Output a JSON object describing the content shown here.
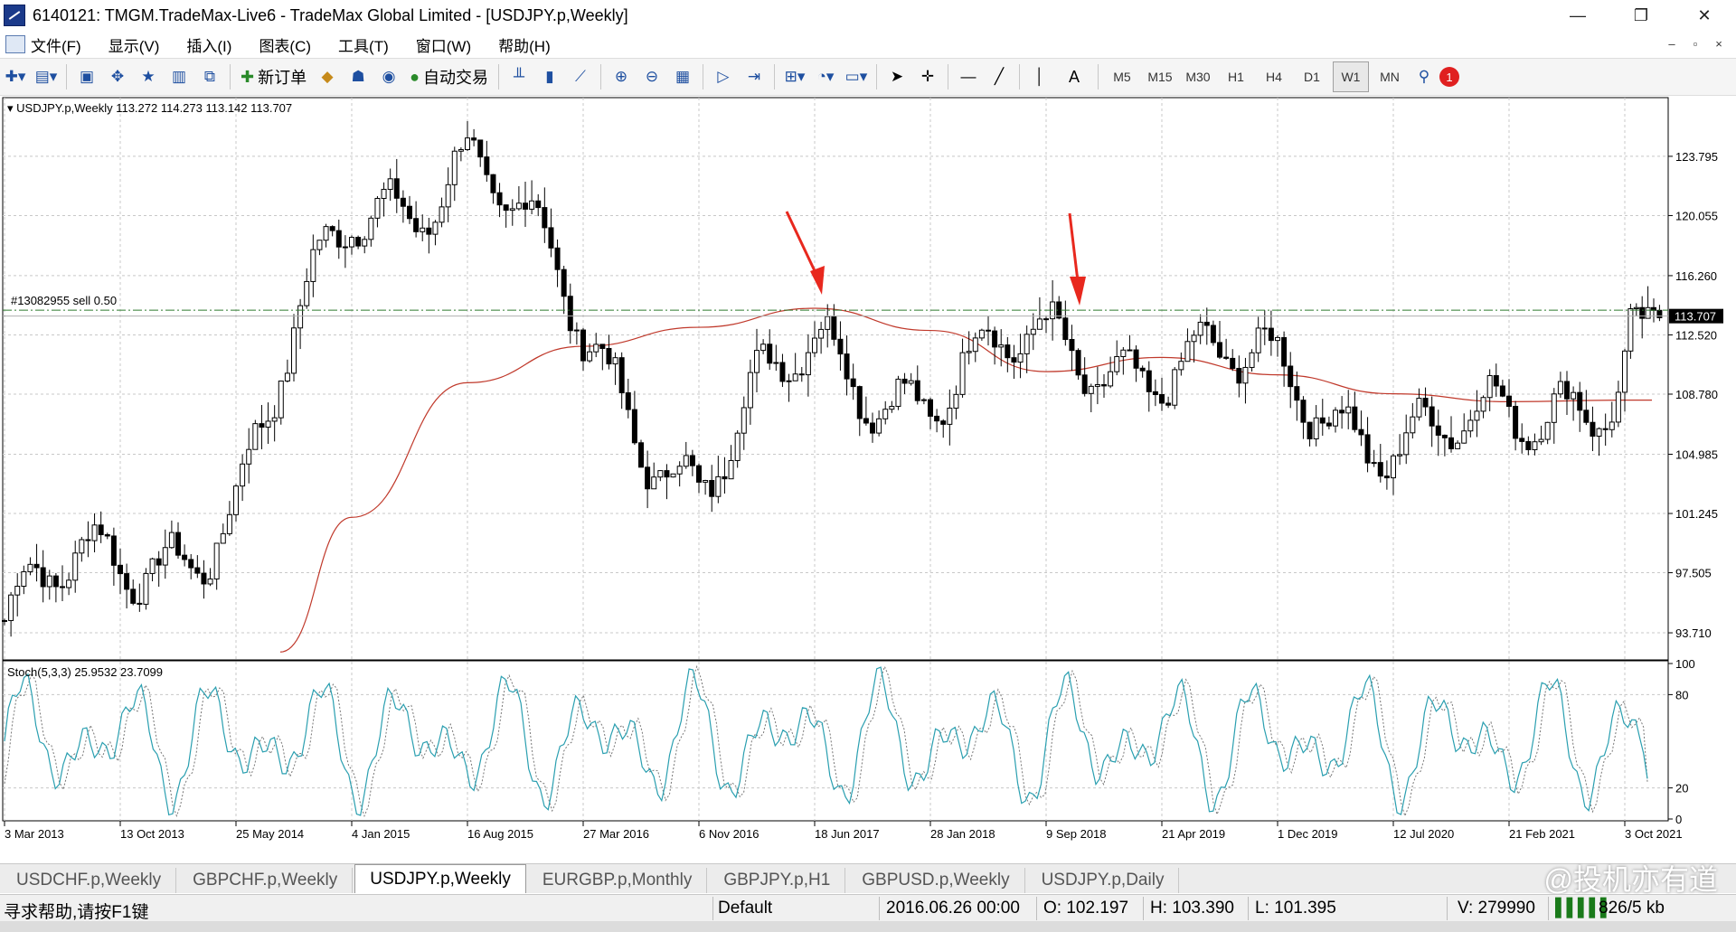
{
  "window": {
    "title": "6140121: TMGM.TradeMax-Live6 - TradeMax Global Limited - [USDJPY.p,Weekly]",
    "min": "—",
    "max": "❐",
    "close": "✕"
  },
  "menu": [
    "文件(F)",
    "显示(V)",
    "插入(I)",
    "图表(C)",
    "工具(T)",
    "窗口(W)",
    "帮助(H)"
  ],
  "mdi": {
    "min": "–",
    "restore": "▫",
    "close": "×"
  },
  "toolbar": {
    "new_order": "新订单",
    "auto_trading": "自动交易",
    "text_tool": "A",
    "timeframes": [
      "M5",
      "M15",
      "M30",
      "H1",
      "H4",
      "D1",
      "W1",
      "MN"
    ],
    "active_timeframe": "W1",
    "alert_count": "1"
  },
  "chart": {
    "header": "USDJPY.p,Weekly  113.272 114.273 113.142 113.707",
    "order_label": "#13082955 sell 0.50",
    "current_price": "113.707",
    "price_ticks": [
      "123.795",
      "120.055",
      "116.260",
      "112.520",
      "108.780",
      "104.985",
      "101.245",
      "97.505",
      "93.710"
    ],
    "stoch_label": "Stoch(5,3,3) 25.9532 23.7099",
    "stoch_ticks": [
      "100",
      "80",
      "20",
      "0"
    ],
    "date_ticks": [
      "3 Mar 2013",
      "13 Oct 2013",
      "25 May 2014",
      "4 Jan 2015",
      "16 Aug 2015",
      "27 Mar 2016",
      "6 Nov 2016",
      "18 Jun 2017",
      "28 Jan 2018",
      "9 Sep 2018",
      "21 Apr 2019",
      "1 Dec 2019",
      "12 Jul 2020",
      "21 Feb 2021",
      "3 Oct 2021"
    ],
    "colors": {
      "candle": "#000000",
      "ma": "#c0392b",
      "arrow": "#e8281e",
      "stoch_main": "#2a9fb0",
      "stoch_signal": "#777777",
      "order_line": "#2d7a2d"
    }
  },
  "chart_data": {
    "type": "candlestick",
    "symbol": "USDJPY.p",
    "timeframe": "Weekly",
    "ylim": [
      92.0,
      127.5
    ],
    "current_price": 113.707,
    "order_level": 114.08,
    "close_series": [
      {
        "date": "3 Mar 2013",
        "close": 94.5
      },
      {
        "date": "13 Oct 2013",
        "close": 98.0
      },
      {
        "date": "25 May 2014",
        "close": 101.8
      },
      {
        "date": "4 Jan 2015",
        "close": 120.0
      },
      {
        "date": "16 Aug 2015",
        "close": 124.3
      },
      {
        "date": "27 Mar 2016",
        "close": 112.0
      },
      {
        "date": "6 Nov 2016",
        "close": 103.5
      },
      {
        "date": "18 Jun 2017",
        "close": 111.2
      },
      {
        "date": "28 Jan 2018",
        "close": 109.5
      },
      {
        "date": "9 Sep 2018",
        "close": 111.0
      },
      {
        "date": "21 Apr 2019",
        "close": 111.7
      },
      {
        "date": "1 Dec 2019",
        "close": 108.8
      },
      {
        "date": "12 Jul 2020",
        "close": 107.2
      },
      {
        "date": "21 Feb 2021",
        "close": 105.3
      },
      {
        "date": "3 Oct 2021",
        "close": 111.5
      }
    ],
    "ma_series": [
      {
        "date": "21 Jan 2014",
        "value": 92.5
      },
      {
        "date": "4 Jan 2015",
        "value": 101.0
      },
      {
        "date": "16 Aug 2015",
        "value": 109.5
      },
      {
        "date": "27 Mar 2016",
        "value": 111.8
      },
      {
        "date": "6 Nov 2016",
        "value": 113.0
      },
      {
        "date": "18 Jun 2017",
        "value": 114.2
      },
      {
        "date": "28 Jan 2018",
        "value": 112.8
      },
      {
        "date": "9 Sep 2018",
        "value": 110.2
      },
      {
        "date": "21 Apr 2019",
        "value": 111.1
      },
      {
        "date": "1 Dec 2019",
        "value": 110.0
      },
      {
        "date": "12 Jul 2020",
        "value": 108.8
      },
      {
        "date": "21 Feb 2021",
        "value": 108.3
      },
      {
        "date": "3 Oct 2021",
        "value": 108.4
      }
    ],
    "stochastic": {
      "main": 25.9532,
      "signal": 23.7099,
      "levels": [
        20,
        80
      ]
    }
  },
  "tabs": [
    "USDCHF.p,Weekly",
    "GBPCHF.p,Weekly",
    "USDJPY.p,Weekly",
    "EURGBP.p,Monthly",
    "GBPJPY.p,H1",
    "GBPUSD.p,Weekly",
    "USDJPY.p,Daily"
  ],
  "active_tab": "USDJPY.p,Weekly",
  "watermark": "@投机亦有道",
  "status": {
    "help": "寻求帮助,请按F1键",
    "profile": "Default",
    "datetime": "2016.06.26 00:00",
    "open": "O: 102.197",
    "high": "H: 103.390",
    "low": "L: 101.395",
    "volume": "V: 279990",
    "traffic": "826/5 kb"
  }
}
